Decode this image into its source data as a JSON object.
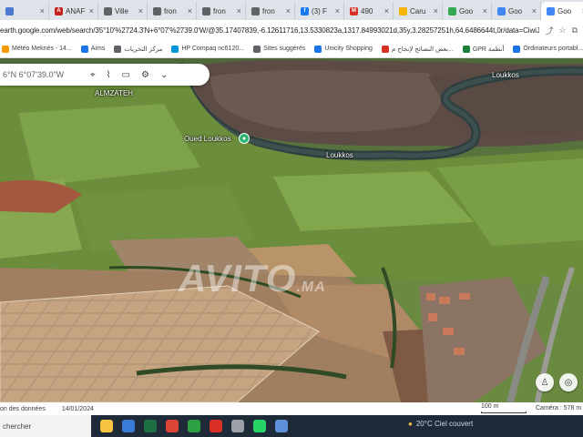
{
  "browser": {
    "tabs": [
      {
        "label": "",
        "color": "#4a7bd0",
        "glyph": "",
        "active": false
      },
      {
        "label": "ANAF",
        "color": "#c5221f",
        "glyph": "A",
        "active": false
      },
      {
        "label": "Ville",
        "color": "#5f6368",
        "glyph": "",
        "active": false
      },
      {
        "label": "fron",
        "color": "#5f6368",
        "glyph": "",
        "active": false
      },
      {
        "label": "fron",
        "color": "#5f6368",
        "glyph": "",
        "active": false
      },
      {
        "label": "fron",
        "color": "#5f6368",
        "glyph": "",
        "active": false
      },
      {
        "label": "(3) F",
        "color": "#1877f2",
        "glyph": "f",
        "active": false
      },
      {
        "label": "490",
        "color": "#d93025",
        "glyph": "M",
        "active": false
      },
      {
        "label": "Caru",
        "color": "#f4b400",
        "glyph": "",
        "active": false
      },
      {
        "label": "Goo",
        "color": "#34a853",
        "glyph": "",
        "active": false
      },
      {
        "label": "Goo",
        "color": "#4285f4",
        "glyph": "",
        "active": false
      },
      {
        "label": "Goo",
        "color": "#4285f4",
        "glyph": "",
        "active": true
      }
    ],
    "url": "earth.google.com/web/search/35°10'%2724.3'N+6°07'%2739.0'W/@35.17407839,-6.12611716,13.5330823a,1317.84993021d,35y,3.28257251h,64.6486644t,0r/data=CiwiJgokCZ"
  },
  "bookmarks": [
    {
      "label": "Météo Meknès - 14...",
      "color": "#f29900"
    },
    {
      "label": "Aims",
      "color": "#1a73e8"
    },
    {
      "label": "مركز التحريات",
      "color": "#5f6368"
    },
    {
      "label": "HP Compaq nc6120...",
      "color": "#0096d6"
    },
    {
      "label": "Sites suggérés",
      "color": "#5f6368"
    },
    {
      "label": "Unicity Shopping",
      "color": "#1a73e8"
    },
    {
      "label": "بعض النصائح لإنجاح م...",
      "color": "#d93025"
    },
    {
      "label": "GPR أنظمة",
      "color": "#188038"
    },
    {
      "label": "Ordinateurs portabl...",
      "color": "#1a73e8"
    }
  ],
  "earth": {
    "search_value": "6°N 6°07'39.0\"W",
    "place_label": "Oued Loukkos",
    "river_label_1": "Loukkos",
    "river_label_2": "Loukkos",
    "town_label": "ALMZATEH",
    "watermark_main": "AVITO",
    "watermark_suffix": ".MA",
    "icons": [
      "pin-icon",
      "ruler-icon",
      "slides-icon",
      "settings-icon",
      "chevron-down-icon"
    ]
  },
  "footer": {
    "attribution": "on des données",
    "date": "14/01/2024",
    "scale": "100 m",
    "camera": "Caméra : 578 m"
  },
  "taskbar": {
    "search_placeholder": "chercher",
    "weather": "20°C Ciel couvert",
    "apps": [
      {
        "name": "file-explorer-icon",
        "color": "#f6c343"
      },
      {
        "name": "store-icon",
        "color": "#3a7bd5"
      },
      {
        "name": "excel-icon",
        "color": "#1d6f42"
      },
      {
        "name": "chrome-icon",
        "color": "#db4437"
      },
      {
        "name": "shield-icon",
        "color": "#2ea043"
      },
      {
        "name": "mail-icon",
        "color": "#d93025"
      },
      {
        "name": "settings-icon",
        "color": "#9aa0a6"
      },
      {
        "name": "whatsapp-icon",
        "color": "#25d366"
      },
      {
        "name": "monitor-icon",
        "color": "#5f8fd8"
      }
    ]
  }
}
